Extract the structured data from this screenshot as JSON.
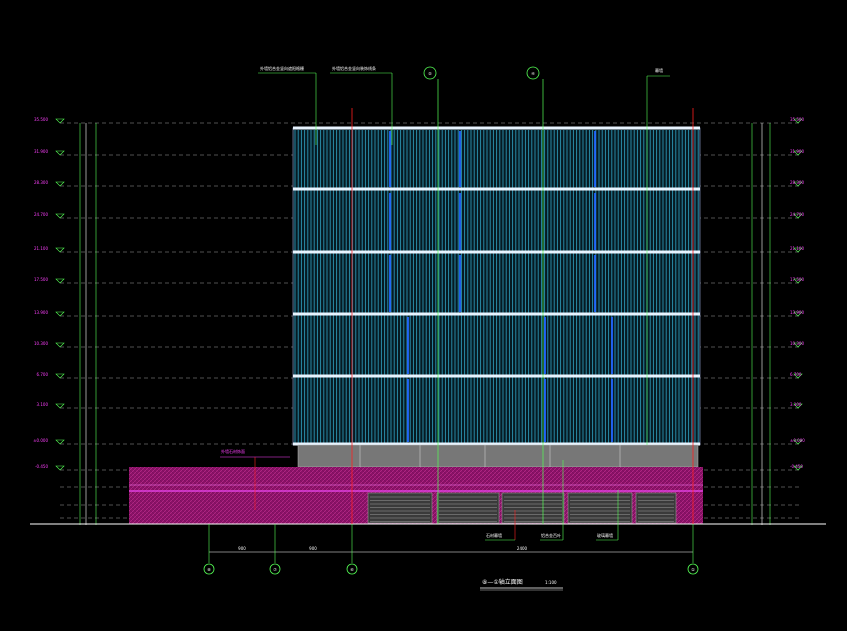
{
  "drawing": {
    "title": "⑧—①轴立面图",
    "scale": "1:100",
    "colors": {
      "background": "#000000",
      "grid_line": "#55ff55",
      "level_tag": "#ff40ff",
      "facade_fin": "#33aacc",
      "accent_fin": "#2266ff",
      "podium": "#aa1177",
      "base_band": "#888888",
      "dim_line": "#ffffff",
      "ref_line": "#ff2020"
    }
  },
  "top_callouts": [
    "外墙铝合金竖向遮阳格栅",
    "外墙铝合金竖向装饰线条",
    "幕墙"
  ],
  "axes": {
    "top": [
      "⑤",
      "④"
    ],
    "bottom": [
      "⑧",
      "⑦",
      "⑥",
      "①"
    ]
  },
  "levels_left": [
    "35.500",
    "31.900",
    "28.300",
    "24.700",
    "21.100",
    "17.500",
    "13.900",
    "10.300",
    "6.700",
    "3.100",
    "±0.000",
    "-0.450"
  ],
  "levels_right": [
    "35.500",
    "31.900",
    "28.300",
    "24.700",
    "21.100",
    "17.500",
    "13.900",
    "10.300",
    "6.700",
    "3.100",
    "±0.000",
    "-0.450"
  ],
  "bottom_dims": [
    "900",
    "900",
    "2400"
  ],
  "bottom_notes": [
    "石材幕墙",
    "铝合金百叶",
    "玻璃幕墙"
  ],
  "podium_note": "外墙石材饰面"
}
